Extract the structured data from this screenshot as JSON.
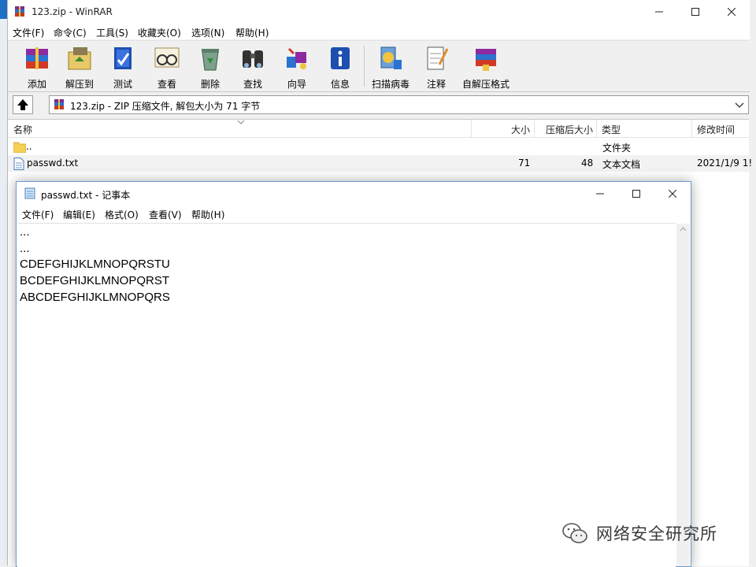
{
  "winrar": {
    "title": "123.zip - WinRAR",
    "menu": [
      "文件(F)",
      "命令(C)",
      "工具(S)",
      "收藏夹(O)",
      "选项(N)",
      "帮助(H)"
    ],
    "toolbar": [
      {
        "label": "添加",
        "icon": "add-books-icon"
      },
      {
        "label": "解压到",
        "icon": "extract-folder-icon"
      },
      {
        "label": "测试",
        "icon": "test-book-icon"
      },
      {
        "label": "查看",
        "icon": "view-glasses-icon"
      },
      {
        "label": "删除",
        "icon": "delete-recycle-icon"
      },
      {
        "label": "查找",
        "icon": "find-binoculars-icon"
      },
      {
        "label": "向导",
        "icon": "wizard-icon"
      },
      {
        "label": "信息",
        "icon": "info-icon"
      },
      {
        "label": "扫描病毒",
        "icon": "virus-scan-icon"
      },
      {
        "label": "注释",
        "icon": "comment-notepad-icon"
      },
      {
        "label": "自解压格式",
        "icon": "sfx-icon"
      }
    ],
    "address": "123.zip - ZIP 压缩文件, 解包大小为 71 字节",
    "columns": {
      "name": "名称",
      "size": "大小",
      "packed": "压缩后大小",
      "type": "类型",
      "modified": "修改时间"
    },
    "rows": [
      {
        "name": "..",
        "size": "",
        "packed": "",
        "type": "文件夹",
        "modified": ""
      },
      {
        "name": "passwd.txt",
        "size": "71",
        "packed": "48",
        "type": "文本文档",
        "modified": "2021/1/9 1!"
      }
    ]
  },
  "notepad": {
    "title": "passwd.txt - 记事本",
    "menu": [
      "文件(F)",
      "编辑(E)",
      "格式(O)",
      "查看(V)",
      "帮助(H)"
    ],
    "lines": [
      "...",
      "...",
      "CDEFGHIJKLMNOPQRSTU",
      "BCDEFGHIJKLMNOPQRST",
      "ABCDEFGHIJKLMNOPQRS"
    ]
  },
  "watermark": {
    "text": "网络安全研究所"
  },
  "colors": {
    "accent": "#1e6fc4",
    "folder": "#f6cf55",
    "notepad_border": "#6f9bd1"
  }
}
